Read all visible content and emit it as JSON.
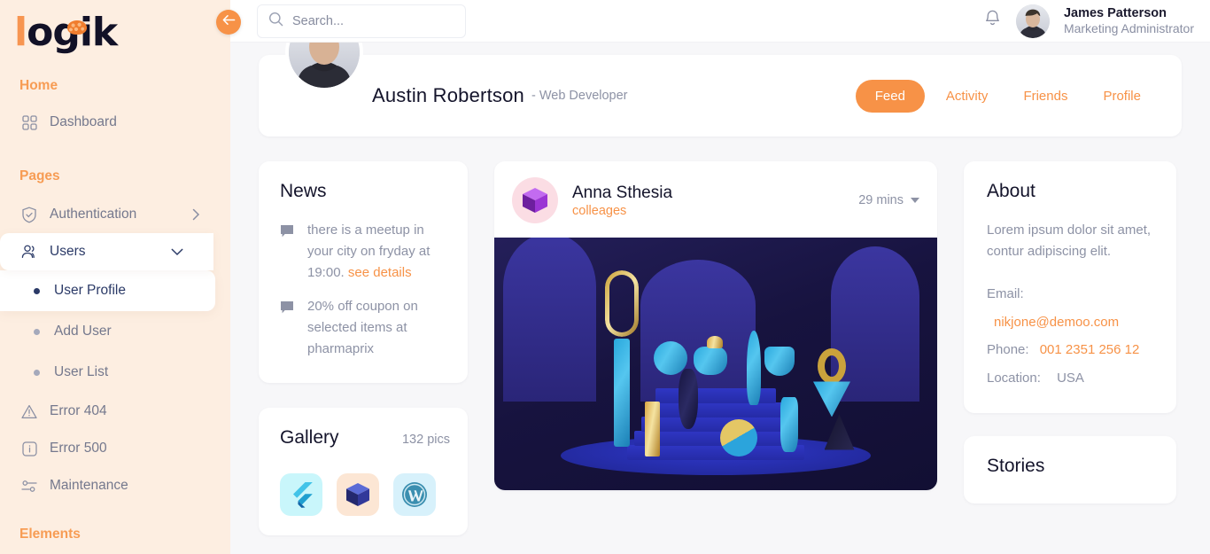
{
  "brand": {
    "name": "logik",
    "first_letter": "l",
    "rest": "ogik",
    "accent": "#f79247"
  },
  "sidebar": {
    "collapse_icon": "arrow-left-icon",
    "sections": [
      {
        "label": "Home"
      },
      {
        "label": "Pages"
      },
      {
        "label": "Elements"
      }
    ],
    "items": [
      {
        "label": "Dashboard",
        "icon": "grid-icon"
      },
      {
        "label": "Authentication",
        "icon": "shield-check-icon",
        "chevron": "chevron-right-icon"
      },
      {
        "label": "Users",
        "icon": "users-icon",
        "chevron": "chevron-down-icon",
        "active": true
      },
      {
        "label": "Error 404",
        "icon": "warning-triangle-icon"
      },
      {
        "label": "Error 500",
        "icon": "info-square-icon"
      },
      {
        "label": "Maintenance",
        "icon": "sliders-icon"
      }
    ],
    "sub_items": [
      {
        "label": "User Profile",
        "active": true
      },
      {
        "label": "Add User",
        "active": false
      },
      {
        "label": "User List",
        "active": false
      }
    ]
  },
  "topbar": {
    "search": {
      "placeholder": "Search...",
      "value": "",
      "icon": "search-icon"
    },
    "notification_icon": "bell-icon",
    "user": {
      "name": "James Patterson",
      "role": "Marketing Administrator",
      "avatar": "user-avatar"
    }
  },
  "profile": {
    "name": "Austin Robertson",
    "role": "- Web Developer",
    "avatar": "profile-avatar",
    "tabs": [
      {
        "label": "Feed",
        "active": true
      },
      {
        "label": "Activity",
        "active": false
      },
      {
        "label": "Friends",
        "active": false
      },
      {
        "label": "Profile",
        "active": false
      }
    ]
  },
  "news": {
    "title": "News",
    "items": [
      {
        "icon": "chat-bubble-icon",
        "text": "there is a meetup in your city on fryday at 19:00. ",
        "link": "see details"
      },
      {
        "icon": "chat-bubble-icon",
        "text": "20% off coupon on selected items at pharmaprix",
        "link": ""
      }
    ]
  },
  "gallery": {
    "title": "Gallery",
    "count": "132 pics",
    "thumbs": [
      {
        "name": "flutter-logo-thumbnail"
      },
      {
        "name": "blue-cube-thumbnail"
      },
      {
        "name": "wordpress-logo-thumbnail"
      }
    ]
  },
  "post": {
    "author": "Anna Sthesia",
    "relation": "colleages",
    "time": "29 mins",
    "menu_icon": "caret-down-icon",
    "avatar_icon": "purple-cube-avatar",
    "image_alt": "blue-3d-vases-render"
  },
  "about": {
    "title": "About",
    "description": "Lorem ipsum dolor sit amet, contur adipiscing elit.",
    "rows": [
      {
        "label": "Email:",
        "value": "nikjone@demoo.com",
        "accent": true
      },
      {
        "label": "Phone:",
        "value": "001 2351 256 12",
        "accent": true
      },
      {
        "label": "Location:",
        "value": "USA",
        "accent": false
      }
    ]
  },
  "stories": {
    "title": "Stories"
  }
}
